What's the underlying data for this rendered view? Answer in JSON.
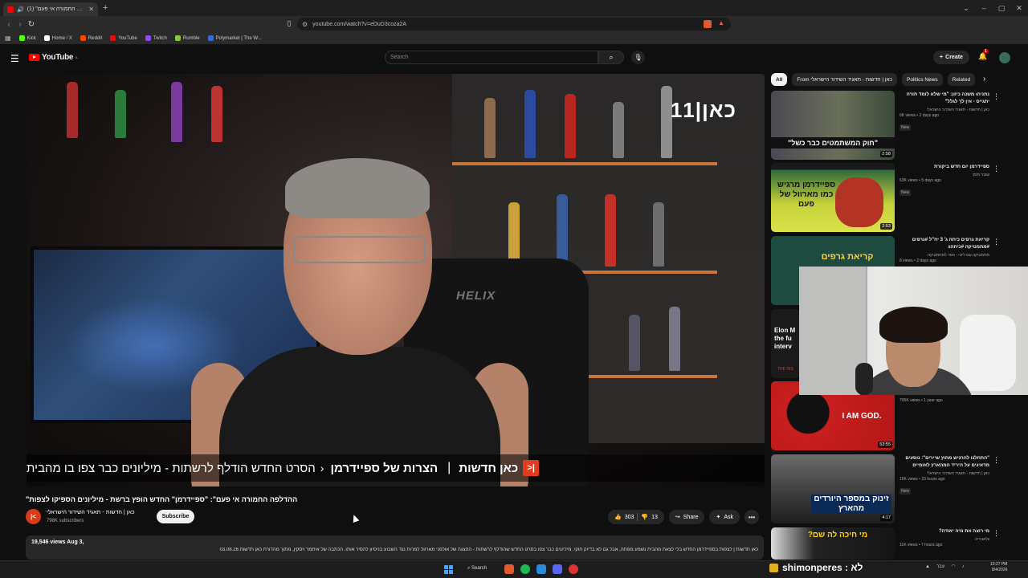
{
  "browser": {
    "tab_title": "(1) \"ההדלפה החמורה אי פעם\"",
    "url": "youtube.com/watch?v=eDuD3coza2A",
    "new_tab_icon": "plus-icon",
    "bookmarks": [
      {
        "label": "Kick",
        "color": "#53fc18"
      },
      {
        "label": "Home / X",
        "color": "#ffffff"
      },
      {
        "label": "Reddit",
        "color": "#ff4500"
      },
      {
        "label": "YouTube",
        "color": "#ff0000"
      },
      {
        "label": "Twitch",
        "color": "#9146ff"
      },
      {
        "label": "Rumble",
        "color": "#85c742"
      },
      {
        "label": "Polymarket | The W...",
        "color": "#2d6cdf"
      }
    ]
  },
  "youtube": {
    "logo": "YouTube",
    "logo_sup": "IL",
    "search_placeholder": "Search",
    "create_label": "Create",
    "notif_count": "1"
  },
  "player": {
    "channel_logo": "כאן|11",
    "lower_badge": "|<",
    "lower_l1": "כאן חדשות",
    "lower_sep": "|",
    "lower_l2": "הצרות של ספיידרמן",
    "lower_chev": "‹",
    "lower_l3": "הסרט החדש הודלף לרשתות - מיליונים כבר צפו בו מהבית",
    "chair_brand": "HELIX"
  },
  "video": {
    "title": "ההדלפה החמורה אי פעם\": \"ספיידרמן\" החדש הופץ ברשת - מיליונים הספיקו לצפות\"",
    "channel_name": "כאן | חדשות - תאגיד השידור הישראלי",
    "channel_avatar": "|<",
    "subscribers": "798K subscribers",
    "subscribe_label": "Subscribe",
    "likes": "303",
    "dislikes": "13",
    "share_label": "Share",
    "ask_label": "Ask",
    "more_label": "•••",
    "views_date": "19,546 views  Aug 3,",
    "desc_text": "כאן חדשות | לצפות בספיידרמן החדש בלי לצאת מהבית נשמע מפתה, אבל גם לא בדיוק חוקי. מיליונים כבר צפו בסרט החדש שהודלף לרשתות - ההצגה של אולפני מארוול למרות נגד השבוע בניסיון להסיר אותו. הכתבה של איתמר ויסקין, מתוך מהדורת כאן חדשות 03.08.26"
  },
  "sidebar": {
    "chips": [
      "All",
      "From כאן | חדשות - תאגיד השידור הישראלי",
      "Politics News",
      "Related"
    ],
    "recs": [
      {
        "title": "נתניהו משנה כיוון: \"מי שלא לומד תורה יתגייס - אין לך לגלל\"",
        "channel": "כאן | חדשות - תאגיד השידור הישראלי",
        "meta": "6K views • 2 days ago",
        "badge": "New",
        "duration": "2:58",
        "thumb_text": "\"חוק המשתמטים כבר כשל\""
      },
      {
        "title": "ספיידרמן יום חדש ביקורת",
        "channel": "שובר מסך",
        "meta": "63K views • 5 days ago",
        "badge": "New",
        "duration": "2:53",
        "thumb_text": "ספיידרמן מרגיש כמו מארוול של פעם"
      },
      {
        "title": "קריאת גרפים כיתה ג' 3 יח\"ל #גרפים #מתמטיקה #כיתהג",
        "channel": "מתמטיקה עם ליטי - ספר למתמטיקה",
        "meta": "8 views • 2 days ago",
        "badge": "",
        "duration": "",
        "thumb_text": "קריאת גרפים"
      },
      {
        "title": "",
        "channel": "",
        "meta": "795K views • 1 year ago",
        "badge": "",
        "duration": "53:55",
        "thumb_text": "I AM GOD."
      },
      {
        "title": "\"התחלנו להרגיש מחוץ שיירים\": נוסעים מדאיגים על היריד המהארץ לאומיים",
        "channel": "כאן | חדשות - תאגיד השידור הישראלי",
        "meta": "15K views • 23 hours ago",
        "badge": "New",
        "duration": "4:17",
        "thumb_text": "זינוק במספר היורדים מהארץ"
      },
      {
        "title": "מי רוצה את מיה יאודה?",
        "channel": "גלאבריה",
        "meta": "11K views • 7 hours ago",
        "badge": "New",
        "duration": "",
        "thumb_text": "מי חיכה לה שם?"
      }
    ],
    "elon_text": "Elon M the fu interv",
    "elon_sub": "THE INS"
  },
  "taskbar": {
    "search_label": "Search",
    "ticker": "shimonperes : לא",
    "lang": "עבר",
    "time": "10:27 PM",
    "date": "8/4/2026"
  },
  "colors": {
    "bg": "#0f0f0f",
    "yt_red": "#ff0000",
    "kan_orange": "#e53a1c"
  }
}
